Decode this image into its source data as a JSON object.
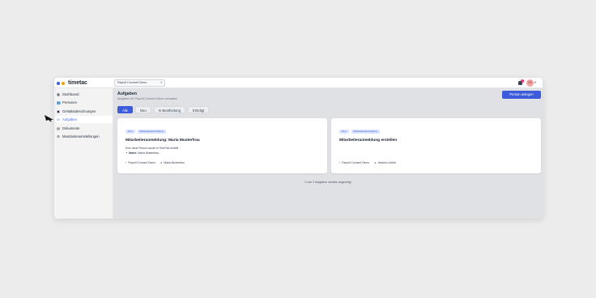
{
  "app": {
    "logo_text": "timetac"
  },
  "topbar": {
    "client_select_value": "Payroll Connect Demo",
    "notification_count": "1",
    "avatar_initials": "SS"
  },
  "sidebar": {
    "items": [
      {
        "label": "Dashboard",
        "icon": "dashboard-icon"
      },
      {
        "label": "Personen",
        "icon": "people-icon"
      },
      {
        "label": "Gehaltsabrechnungen",
        "icon": "payroll-icon"
      },
      {
        "label": "Aufgaben",
        "icon": "tasks-icon",
        "active": true
      },
      {
        "label": "Dokumente",
        "icon": "document-icon"
      },
      {
        "label": "Mandanteneinstellungen",
        "icon": "settings-icon"
      }
    ]
  },
  "page": {
    "title": "Aufgaben",
    "subtitle": "Aufgaben für Payroll Connect Demo verwalten",
    "primary_button": "Person anlegen"
  },
  "filters": [
    "Alle",
    "Neu",
    "In Bearbeitung",
    "Erledigt"
  ],
  "tasks": [
    {
      "badges": [
        "Neu",
        "Mitarbeiteranmeldung"
      ],
      "title": "Mitarbeiteranmeldung: Maria Musterfrau",
      "description": "Eine neue Person wurde in TimeTac erstellt",
      "detail_label": "Name:",
      "detail_value": "Maria Musterfrau...",
      "client": "Payroll Connect Demo",
      "person": "Maria Musterfrau"
    },
    {
      "badges": [
        "Neu",
        "Mitarbeiteranmeldung"
      ],
      "title": "Mitarbeiteranmeldung erstellen",
      "client": "Payroll Connect Demo",
      "person": "Jessica Liebich"
    }
  ],
  "pager": {
    "text": "2 von 2 Aufgaben werden angezeigt"
  },
  "colors": {
    "accent": "#3b5bdb",
    "badge_bg": "#dbe4ff",
    "logo_blue": "#3b5bdb",
    "logo_orange": "#f59f00"
  }
}
